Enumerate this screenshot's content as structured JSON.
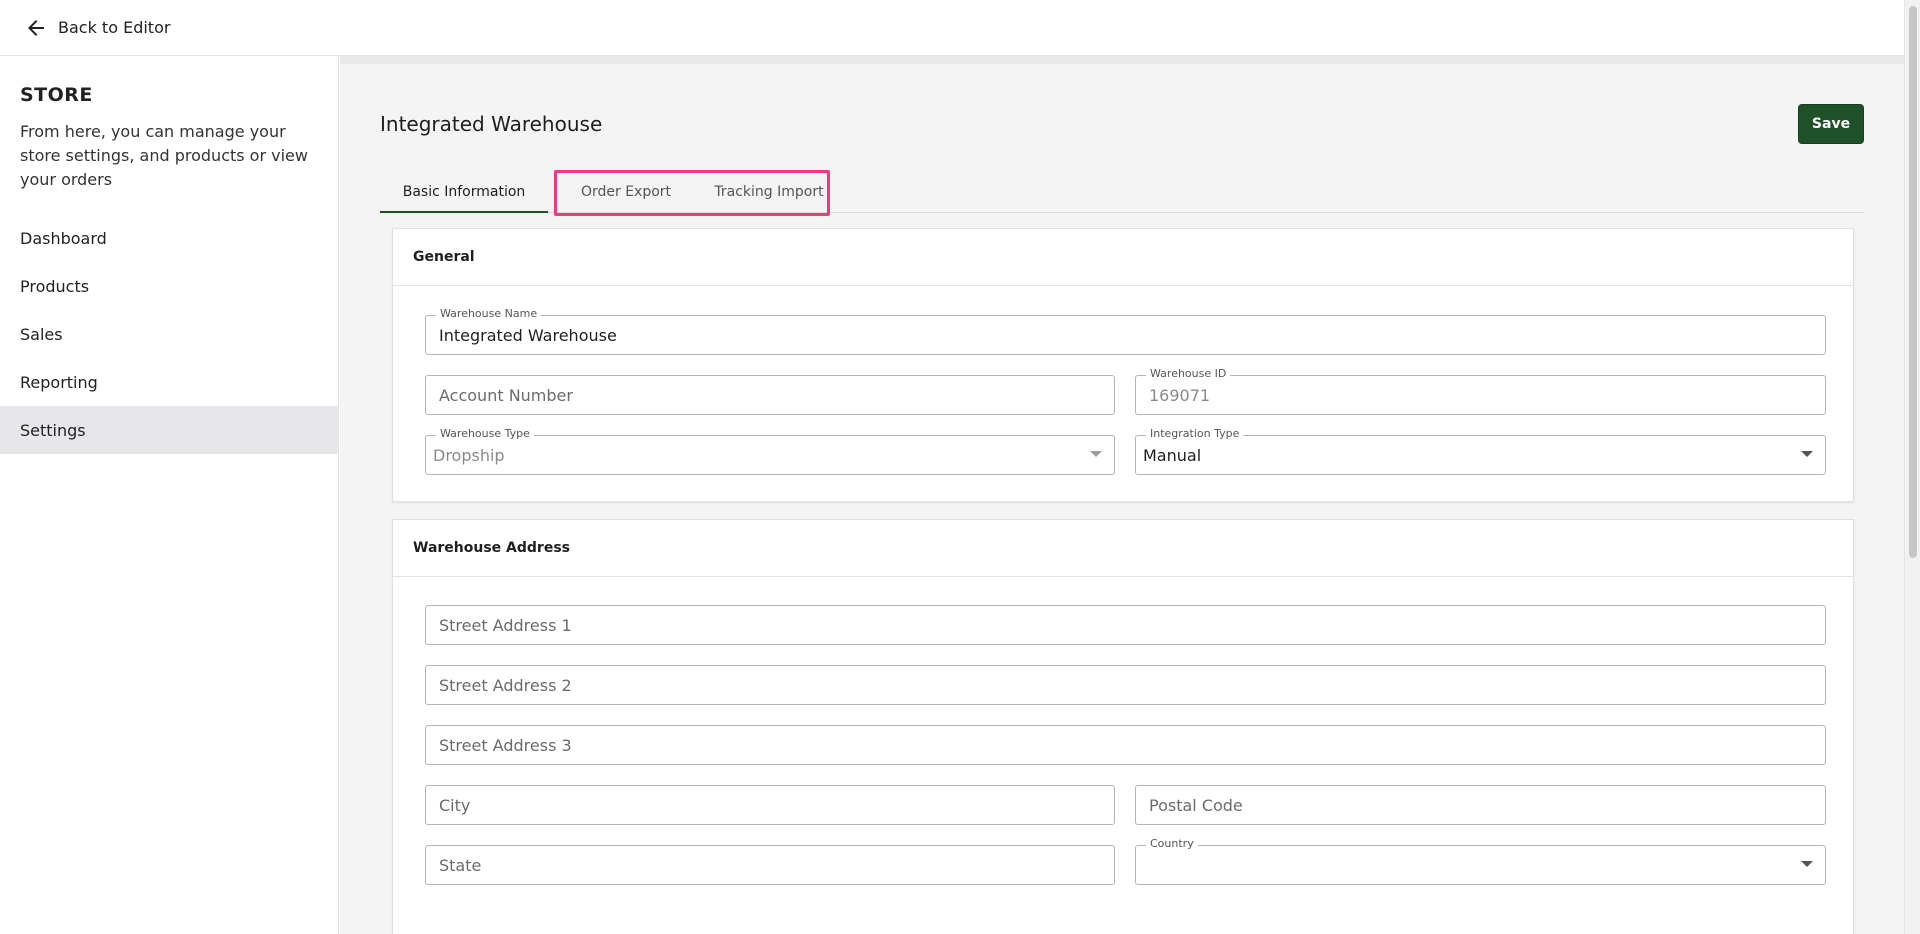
{
  "topbar": {
    "back_label": "Back to Editor"
  },
  "sidebar": {
    "title": "STORE",
    "description": "From here, you can manage your store settings, and products or view your orders",
    "items": [
      {
        "label": "Dashboard"
      },
      {
        "label": "Products"
      },
      {
        "label": "Sales"
      },
      {
        "label": "Reporting"
      },
      {
        "label": "Settings",
        "active": true
      }
    ]
  },
  "main": {
    "title": "Integrated Warehouse",
    "save_label": "Save",
    "tabs": [
      {
        "label": "Basic Information",
        "active": true
      },
      {
        "label": "Order Export"
      },
      {
        "label": "Tracking Import"
      }
    ]
  },
  "general": {
    "header": "General",
    "warehouse_name": {
      "label": "Warehouse Name",
      "value": "Integrated Warehouse"
    },
    "account_number": {
      "placeholder": "Account Number"
    },
    "warehouse_id": {
      "label": "Warehouse ID",
      "value": "169071"
    },
    "warehouse_type": {
      "label": "Warehouse Type",
      "value": "Dropship"
    },
    "integration_type": {
      "label": "Integration Type",
      "value": "Manual"
    }
  },
  "address": {
    "header": "Warehouse Address",
    "street1": {
      "placeholder": "Street Address 1"
    },
    "street2": {
      "placeholder": "Street Address 2"
    },
    "street3": {
      "placeholder": "Street Address 3"
    },
    "city": {
      "placeholder": "City"
    },
    "postal_code": {
      "placeholder": "Postal Code"
    },
    "state": {
      "placeholder": "State"
    },
    "country": {
      "label": "Country",
      "value": ""
    }
  },
  "colors": {
    "accent": "#1e5128",
    "highlight": "#ec3c7e",
    "active_nav_bg": "#e7e7ea"
  },
  "icons": {
    "back": "arrow-left-icon",
    "dropdown": "caret-down-icon"
  }
}
